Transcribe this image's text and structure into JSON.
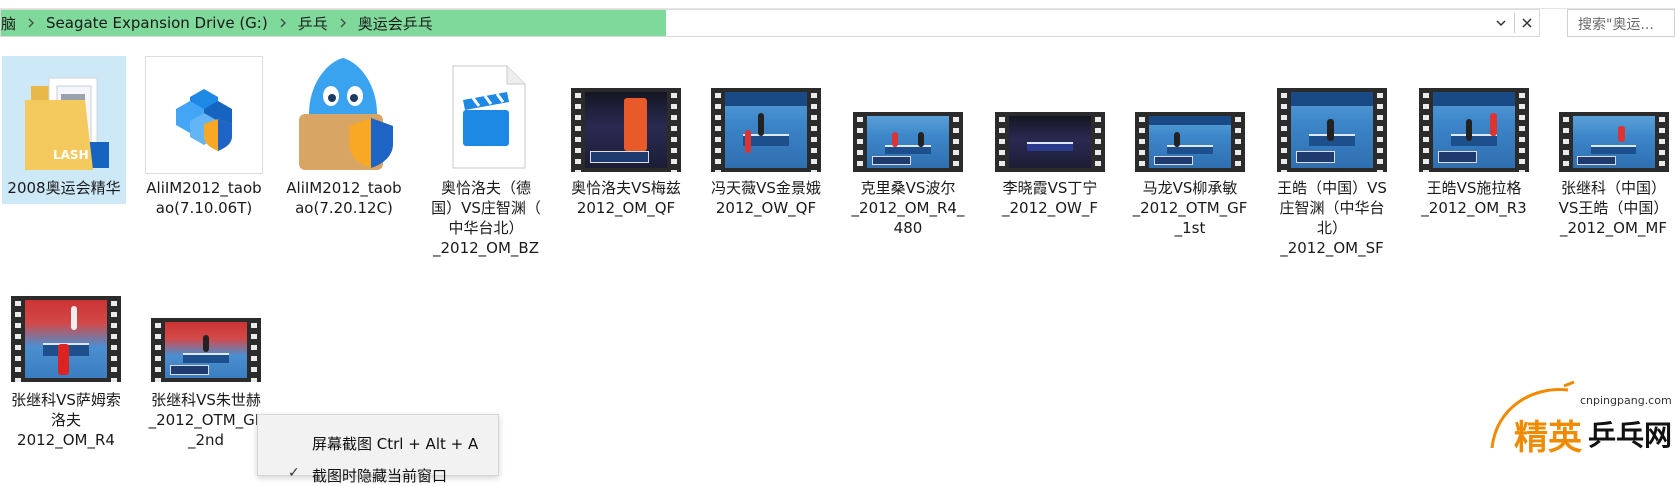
{
  "address_bar": {
    "breadcrumbs": [
      "脑",
      "Seagate Expansion Drive (G:)",
      "乒乓",
      "奥运会乒乓"
    ],
    "dropdown_icon": "chevron-down-icon",
    "close_icon": "close-icon",
    "progress_color": "#7fd99a"
  },
  "search": {
    "placeholder": "搜索\"奥运..."
  },
  "items": [
    {
      "label": "2008奥运会精华",
      "kind": "folder",
      "icon": "folder-icon",
      "selected": true,
      "folder_badge": "LASH"
    },
    {
      "label": "AliIM2012_taob\nao(7.10.06T)",
      "kind": "installer",
      "icon": "installer-icon"
    },
    {
      "label": "AliIM2012_taob\nao(7.20.12C)",
      "kind": "app",
      "icon": "taobao-app-icon"
    },
    {
      "label": "奥恰洛夫（德\n国）VS庄智渊（\n中华台北）\n_2012_OM_BZ",
      "kind": "video-file",
      "icon": "video-file-icon"
    },
    {
      "label": "奥恰洛夫VS梅兹\n2012_OM_QF",
      "kind": "video",
      "scene": "dark"
    },
    {
      "label": "冯天薇VS金景娥\n2012_OW_QF",
      "kind": "video",
      "scene": "blue"
    },
    {
      "label": "克里桑VS波尔\n_2012_OM_R4_\n480",
      "kind": "video",
      "scene": "blue"
    },
    {
      "label": "李晓霞VS丁宁\n_2012_OW_F",
      "kind": "video",
      "scene": "dark"
    },
    {
      "label": "马龙VS柳承敏\n_2012_OTM_GF\n_1st",
      "kind": "video",
      "scene": "blue"
    },
    {
      "label": "王皓（中国）VS\n庄智渊（中华台\n北）\n_2012_OM_SF",
      "kind": "video",
      "scene": "blue"
    },
    {
      "label": "王皓VS施拉格\n_2012_OM_R3",
      "kind": "video",
      "scene": "blue"
    },
    {
      "label": "张继科（中国）\nVS王皓（中国）\n_2012_OM_MF",
      "kind": "video",
      "scene": "blue"
    },
    {
      "label": "张继科VS萨姆索\n洛夫\n2012_OM_R4",
      "kind": "video",
      "scene": "red"
    },
    {
      "label": "张继科VS朱世赫\n_2012_OTM_GF\n_2nd",
      "kind": "video",
      "scene": "red"
    }
  ],
  "context_menu": {
    "items": [
      {
        "label": "屏幕截图 Ctrl + Alt + A"
      },
      {
        "label": "截图时隐藏当前窗口",
        "checked": true
      }
    ]
  },
  "watermark": {
    "site": "cnpingpang.com",
    "name_part1": "精英",
    "name_part2": "乒乓网"
  },
  "colors": {
    "selection": "#cde8f7",
    "accent": "#f08a00",
    "film": "#2b2b2b"
  }
}
